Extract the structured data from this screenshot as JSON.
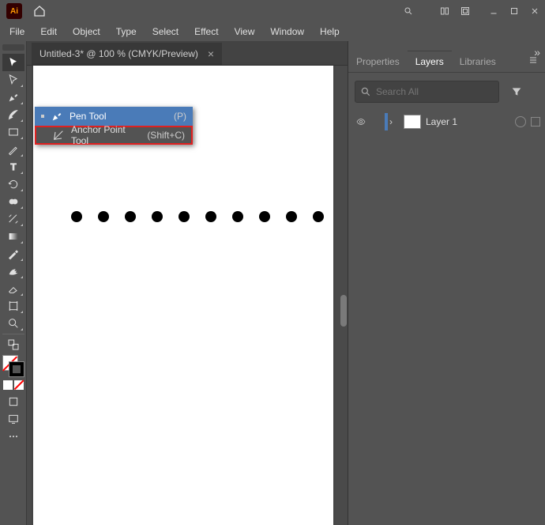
{
  "app": {
    "short": "Ai"
  },
  "menu": [
    "File",
    "Edit",
    "Object",
    "Type",
    "Select",
    "Effect",
    "View",
    "Window",
    "Help"
  ],
  "document": {
    "tab_label": "Untitled-3* @ 100 % (CMYK/Preview)",
    "dot_count": 10
  },
  "flyout": {
    "items": [
      {
        "name": "Pen Tool",
        "shortcut": "(P)",
        "highlighted": true,
        "icon": "pen-icon",
        "bullet": true
      },
      {
        "name": "Anchor Point Tool",
        "shortcut": "(Shift+C)",
        "highlighted": false,
        "icon": "anchor-point-icon",
        "bullet": false,
        "red_outline": true
      }
    ]
  },
  "panels": {
    "tabs": [
      "Properties",
      "Layers",
      "Libraries"
    ],
    "active_tab": "Layers",
    "search_placeholder": "Search All",
    "layers": [
      {
        "name": "Layer 1",
        "visible": true,
        "color": "#4a7bb8"
      }
    ]
  }
}
